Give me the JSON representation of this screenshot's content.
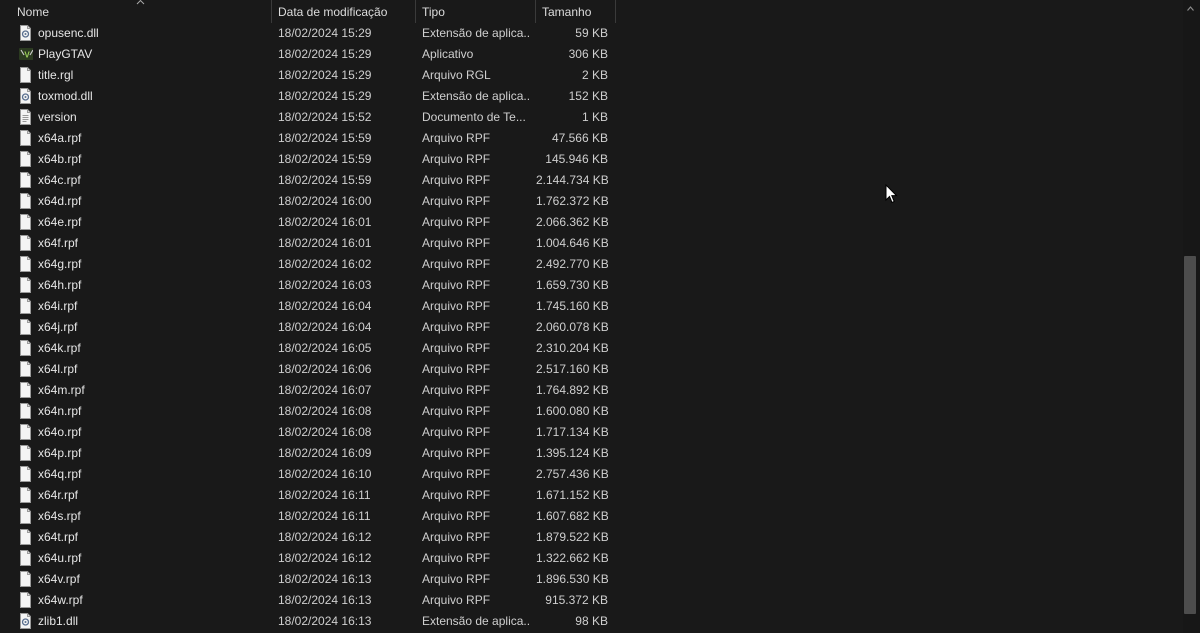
{
  "columns": {
    "name": "Nome",
    "date": "Data de modificação",
    "type": "Tipo",
    "size": "Tamanho"
  },
  "icons": {
    "dll": "dll-gear-file-icon",
    "app": "gta-app-icon",
    "file": "blank-file-icon",
    "text": "text-document-icon"
  },
  "files": [
    {
      "name": "opusenc.dll",
      "date": "18/02/2024 15:29",
      "type": "Extensão de aplica...",
      "size": "59 KB",
      "icon": "dll"
    },
    {
      "name": "PlayGTAV",
      "date": "18/02/2024 15:29",
      "type": "Aplicativo",
      "size": "306 KB",
      "icon": "app"
    },
    {
      "name": "title.rgl",
      "date": "18/02/2024 15:29",
      "type": "Arquivo RGL",
      "size": "2 KB",
      "icon": "file"
    },
    {
      "name": "toxmod.dll",
      "date": "18/02/2024 15:29",
      "type": "Extensão de aplica...",
      "size": "152 KB",
      "icon": "dll"
    },
    {
      "name": "version",
      "date": "18/02/2024 15:52",
      "type": "Documento de Te...",
      "size": "1 KB",
      "icon": "text"
    },
    {
      "name": "x64a.rpf",
      "date": "18/02/2024 15:59",
      "type": "Arquivo RPF",
      "size": "47.566 KB",
      "icon": "file"
    },
    {
      "name": "x64b.rpf",
      "date": "18/02/2024 15:59",
      "type": "Arquivo RPF",
      "size": "145.946 KB",
      "icon": "file"
    },
    {
      "name": "x64c.rpf",
      "date": "18/02/2024 15:59",
      "type": "Arquivo RPF",
      "size": "2.144.734 KB",
      "icon": "file"
    },
    {
      "name": "x64d.rpf",
      "date": "18/02/2024 16:00",
      "type": "Arquivo RPF",
      "size": "1.762.372 KB",
      "icon": "file"
    },
    {
      "name": "x64e.rpf",
      "date": "18/02/2024 16:01",
      "type": "Arquivo RPF",
      "size": "2.066.362 KB",
      "icon": "file"
    },
    {
      "name": "x64f.rpf",
      "date": "18/02/2024 16:01",
      "type": "Arquivo RPF",
      "size": "1.004.646 KB",
      "icon": "file"
    },
    {
      "name": "x64g.rpf",
      "date": "18/02/2024 16:02",
      "type": "Arquivo RPF",
      "size": "2.492.770 KB",
      "icon": "file"
    },
    {
      "name": "x64h.rpf",
      "date": "18/02/2024 16:03",
      "type": "Arquivo RPF",
      "size": "1.659.730 KB",
      "icon": "file"
    },
    {
      "name": "x64i.rpf",
      "date": "18/02/2024 16:04",
      "type": "Arquivo RPF",
      "size": "1.745.160 KB",
      "icon": "file"
    },
    {
      "name": "x64j.rpf",
      "date": "18/02/2024 16:04",
      "type": "Arquivo RPF",
      "size": "2.060.078 KB",
      "icon": "file"
    },
    {
      "name": "x64k.rpf",
      "date": "18/02/2024 16:05",
      "type": "Arquivo RPF",
      "size": "2.310.204 KB",
      "icon": "file"
    },
    {
      "name": "x64l.rpf",
      "date": "18/02/2024 16:06",
      "type": "Arquivo RPF",
      "size": "2.517.160 KB",
      "icon": "file"
    },
    {
      "name": "x64m.rpf",
      "date": "18/02/2024 16:07",
      "type": "Arquivo RPF",
      "size": "1.764.892 KB",
      "icon": "file"
    },
    {
      "name": "x64n.rpf",
      "date": "18/02/2024 16:08",
      "type": "Arquivo RPF",
      "size": "1.600.080 KB",
      "icon": "file"
    },
    {
      "name": "x64o.rpf",
      "date": "18/02/2024 16:08",
      "type": "Arquivo RPF",
      "size": "1.717.134 KB",
      "icon": "file"
    },
    {
      "name": "x64p.rpf",
      "date": "18/02/2024 16:09",
      "type": "Arquivo RPF",
      "size": "1.395.124 KB",
      "icon": "file"
    },
    {
      "name": "x64q.rpf",
      "date": "18/02/2024 16:10",
      "type": "Arquivo RPF",
      "size": "2.757.436 KB",
      "icon": "file"
    },
    {
      "name": "x64r.rpf",
      "date": "18/02/2024 16:11",
      "type": "Arquivo RPF",
      "size": "1.671.152 KB",
      "icon": "file"
    },
    {
      "name": "x64s.rpf",
      "date": "18/02/2024 16:11",
      "type": "Arquivo RPF",
      "size": "1.607.682 KB",
      "icon": "file"
    },
    {
      "name": "x64t.rpf",
      "date": "18/02/2024 16:12",
      "type": "Arquivo RPF",
      "size": "1.879.522 KB",
      "icon": "file"
    },
    {
      "name": "x64u.rpf",
      "date": "18/02/2024 16:12",
      "type": "Arquivo RPF",
      "size": "1.322.662 KB",
      "icon": "file"
    },
    {
      "name": "x64v.rpf",
      "date": "18/02/2024 16:13",
      "type": "Arquivo RPF",
      "size": "1.896.530 KB",
      "icon": "file"
    },
    {
      "name": "x64w.rpf",
      "date": "18/02/2024 16:13",
      "type": "Arquivo RPF",
      "size": "915.372 KB",
      "icon": "file"
    },
    {
      "name": "zlib1.dll",
      "date": "18/02/2024 16:13",
      "type": "Extensão de aplica...",
      "size": "98 KB",
      "icon": "dll"
    }
  ]
}
